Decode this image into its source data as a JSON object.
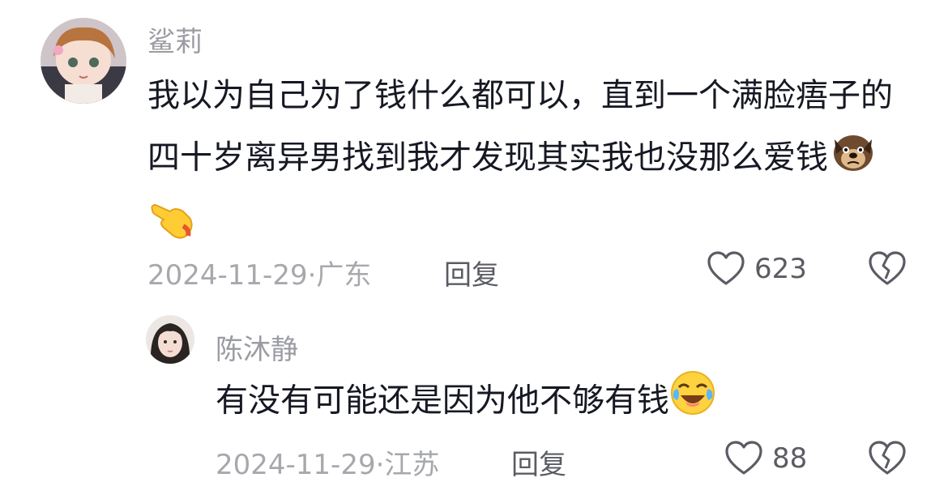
{
  "comments": [
    {
      "username": "鲨莉",
      "text": "我以为自己为了钱什么都可以，直到一个满脸痦子的四十岁离异男找到我才发现其实我也没那么爱钱",
      "emojis": [
        "dog-face-emoji",
        "pointing-hand-emoji"
      ],
      "date": "2024-11-29",
      "location": "广东",
      "reply_label": "回复",
      "likes": "623"
    },
    {
      "username": "陈沐静",
      "text": "有没有可能还是因为他不够有钱",
      "emojis": [
        "laughing-crying-emoji"
      ],
      "date": "2024-11-29",
      "location": "江苏",
      "reply_label": "回复",
      "likes": "88"
    }
  ],
  "separator": "·"
}
